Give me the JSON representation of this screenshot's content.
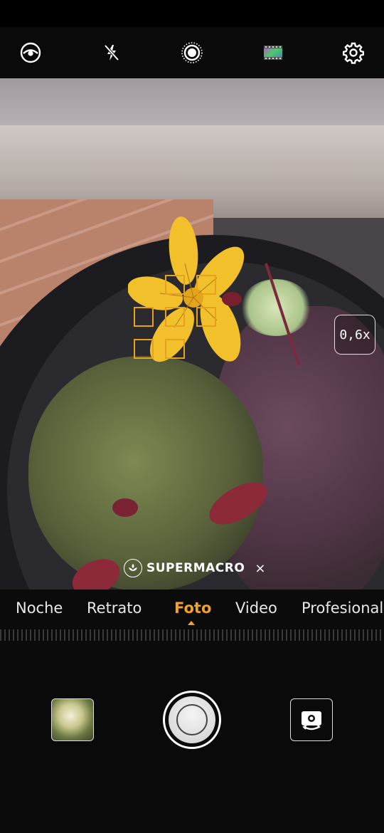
{
  "top_bar": {
    "icons": [
      "ai-eye-icon",
      "flash-off-icon",
      "aperture-icon",
      "filter-icon",
      "gear-icon"
    ]
  },
  "viewfinder": {
    "zoom_level": "0,6x",
    "macro_label": "SUPERMACRO",
    "macro_close": "×"
  },
  "modes": {
    "items": [
      "Noche",
      "Retrato",
      "Foto",
      "Video",
      "Profesional"
    ],
    "active": "Foto"
  },
  "colors": {
    "accent": "#f2a12b",
    "focus": "#e6a21e"
  }
}
